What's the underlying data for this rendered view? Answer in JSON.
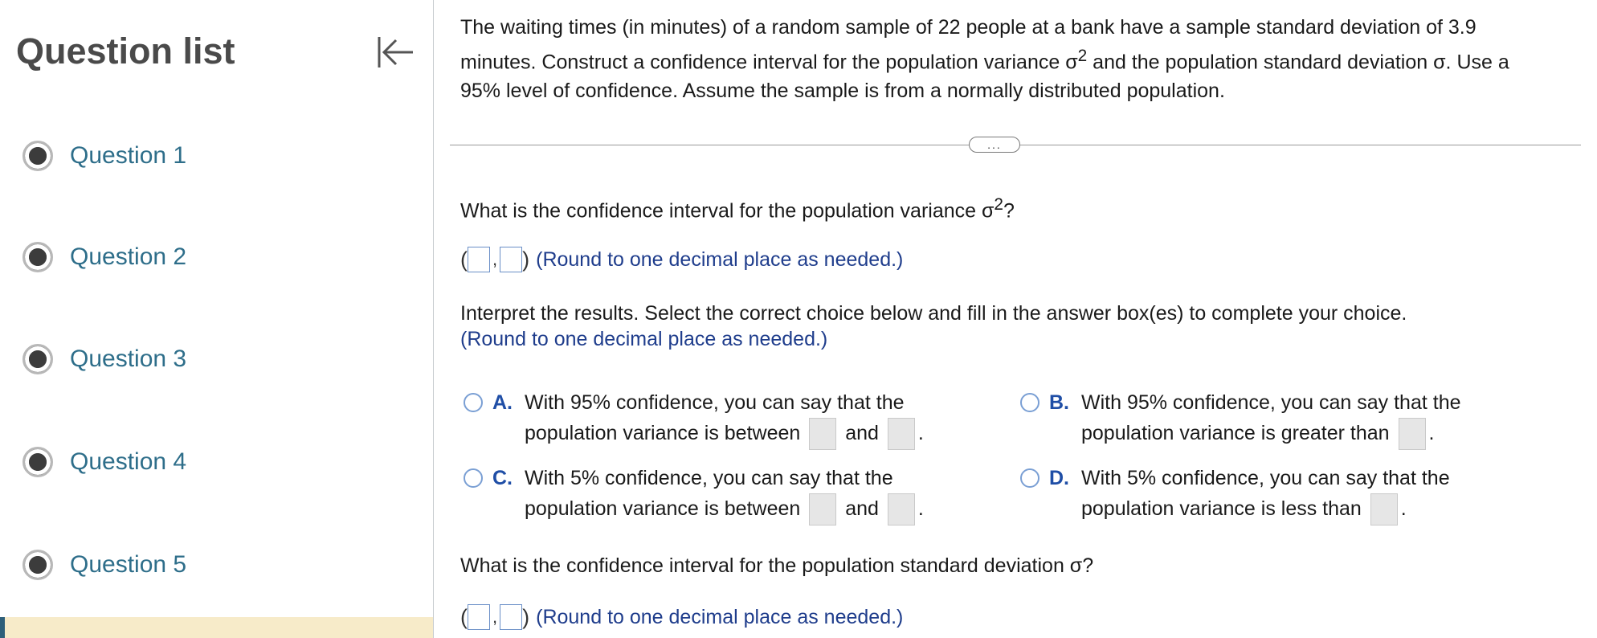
{
  "sidebar": {
    "title": "Question list",
    "items": [
      {
        "label": "Question 1"
      },
      {
        "label": "Question 2"
      },
      {
        "label": "Question 3"
      },
      {
        "label": "Question 4"
      },
      {
        "label": "Question 5"
      }
    ]
  },
  "question": {
    "stem_line1": "The waiting times (in minutes) of a random sample of 22 people at a bank have a sample standard deviation of 3.9",
    "stem_line2_a": "minutes. Construct a confidence interval for the population variance σ",
    "stem_line2_sup": "2",
    "stem_line2_b": " and the population standard deviation σ. Use a",
    "stem_line3": "95% level of confidence. Assume the sample is from a normally distributed population.",
    "more_label": "...",
    "part1_a": "What is the confidence interval for the population variance σ",
    "part1_sup": "2",
    "part1_b": "?",
    "round_hint": "(Round to one decimal place as needed.)",
    "interpret_prompt": "Interpret the results. Select the correct choice below and fill in the answer box(es) to complete your choice.",
    "choices": {
      "a": {
        "letter": "A.",
        "line1": "With 95% confidence, you can say that the",
        "line2": "population variance is between",
        "and": "and",
        "end": "."
      },
      "b": {
        "letter": "B.",
        "line1": "With 95% confidence, you can say that the",
        "line2": "population variance is greater than",
        "end": "."
      },
      "c": {
        "letter": "C.",
        "line1": "With 5% confidence, you can say that the",
        "line2": "population variance is between",
        "and": "and",
        "end": "."
      },
      "d": {
        "letter": "D.",
        "line1": "With 5% confidence, you can say that the",
        "line2": "population variance is less than",
        "end": "."
      }
    },
    "part2": "What is the confidence interval for the population standard deviation σ?",
    "open_paren": "(",
    "comma": ",",
    "close_paren": ")"
  }
}
